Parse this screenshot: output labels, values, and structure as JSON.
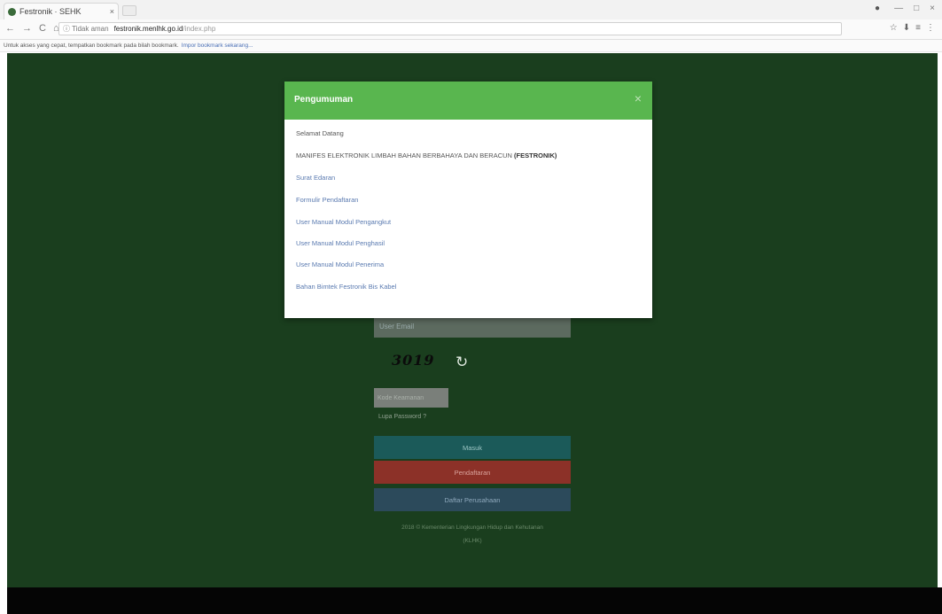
{
  "browser": {
    "tab_title": "Festronik · SEHK",
    "tab_close": "×",
    "nav": {
      "back": "←",
      "forward": "→",
      "reload": "C",
      "home": "⌂"
    },
    "insecure_label": "ⓘ Tidak aman",
    "url_host": "festronik.menlhk.go.id",
    "url_path": "/index.php",
    "window_controls": {
      "minimize": "—",
      "maximize": "□",
      "close": "×"
    },
    "profile_icon": "●",
    "extensions": [
      "☆",
      "⬇",
      "≡",
      "⋮"
    ],
    "infobar_text": "Untuk akses yang cepat, tempatkan bookmark pada bilah bookmark.",
    "infobar_link": "Impor bookmark sekarang..."
  },
  "modal": {
    "title": "Pengumuman",
    "close": "×",
    "lines": [
      {
        "text": "Selamat Datang",
        "type": "text"
      },
      {
        "text": "MANIFES ELEKTRONIK LIMBAH BAHAN BERBAHAYA DAN BERACUN",
        "type": "text",
        "bold_suffix": "(FESTRONIK)"
      },
      {
        "text": "Surat Edaran",
        "type": "link"
      },
      {
        "text": "Formulir Pendaftaran",
        "type": "link"
      },
      {
        "text": "User Manual Modul Pengangkut",
        "type": "link"
      },
      {
        "text": "User Manual Modul Penghasil",
        "type": "link"
      },
      {
        "text": "User Manual Modul Penerima",
        "type": "link"
      },
      {
        "text": "Bahan Bimtek Festronik Bis Kabel",
        "type": "link"
      }
    ]
  },
  "form": {
    "email_placeholder": "User Email",
    "captcha_text": "3019",
    "refresh_icon": "↻",
    "captcha_placeholder": "Kode Keamanan",
    "forgot_password": "Lupa Password ?",
    "login_button": "Masuk",
    "register_button": "Pendaftaran",
    "company_button": "Daftar Perusahaan",
    "footer_line1": "2018 © Kementerian Lingkungan Hidup dan Kehutanan",
    "footer_line2": "(KLHK)"
  },
  "colors": {
    "page_bg": "#1a3e1e",
    "modal_header": "#59b64f",
    "login": "#1b5a59",
    "register": "#8c3128",
    "company": "#2c4a5b"
  }
}
